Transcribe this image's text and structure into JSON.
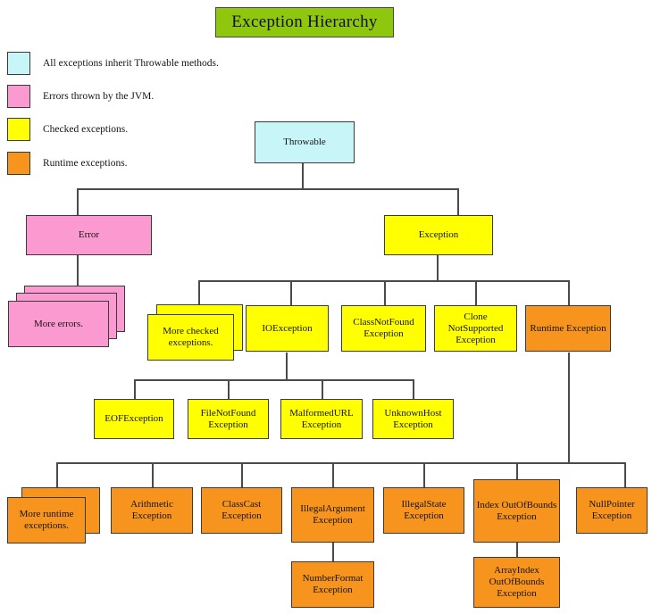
{
  "title": "Exception Hierarchy",
  "legend": {
    "items": [
      {
        "color": "#c8f5f8",
        "label": "All exceptions inherit Throwable methods.",
        "name": "legend-throwable"
      },
      {
        "color": "#fb9ad0",
        "label": "Errors thrown by the JVM.",
        "name": "legend-error"
      },
      {
        "color": "#ffff00",
        "label": "Checked exceptions.",
        "name": "legend-checked"
      },
      {
        "color": "#f7941d",
        "label": "Runtime exceptions.",
        "name": "legend-runtime"
      }
    ]
  },
  "colors": {
    "title_bg": "#8fc70f",
    "cyan": "#c8f5f8",
    "pink": "#fb9ad0",
    "yellow": "#ffff00",
    "orange": "#f7941d",
    "line": "#4a4a4a"
  },
  "nodes": {
    "throwable": "Throwable",
    "error": "Error",
    "more_errors": "More errors.",
    "exception": "Exception",
    "more_checked": "More checked exceptions.",
    "ioexception": "IOException",
    "class_not_found": "ClassNotFound Exception",
    "clone_not_supported": "Clone NotSupported Exception",
    "runtime_exception": "Runtime Exception",
    "eof_exception": "EOFException",
    "file_not_found": "FileNotFound Exception",
    "malformed_url": "MalformedURL Exception",
    "unknown_host": "UnknownHost Exception",
    "more_runtime": "More runtime exceptions.",
    "arithmetic": "Arithmetic Exception",
    "class_cast": "ClassCast Exception",
    "illegal_argument": "IllegalArgument Exception",
    "illegal_state": "IllegalState Exception",
    "index_out_of_bounds": "Index OutOfBounds Exception",
    "null_pointer": "NullPointer Exception",
    "number_format": "NumberFormat Exception",
    "array_index_out_of_bounds": "ArrayIndex OutOfBounds Exception"
  }
}
